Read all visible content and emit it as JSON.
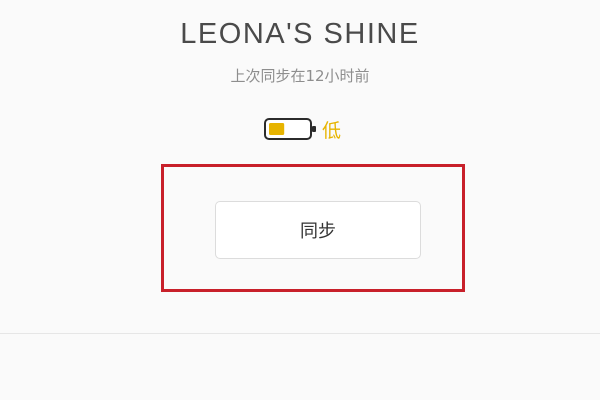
{
  "device": {
    "name": "LEONA'S SHINE",
    "last_sync": "上次同步在12小时前"
  },
  "battery": {
    "icon": "battery-low-icon",
    "level": 0.4,
    "label": "低",
    "color": "#e7b400"
  },
  "actions": {
    "sync_label": "同步"
  },
  "colors": {
    "highlight": "#c8202a",
    "background": "#fafafa",
    "text": "#4a4a4a"
  }
}
